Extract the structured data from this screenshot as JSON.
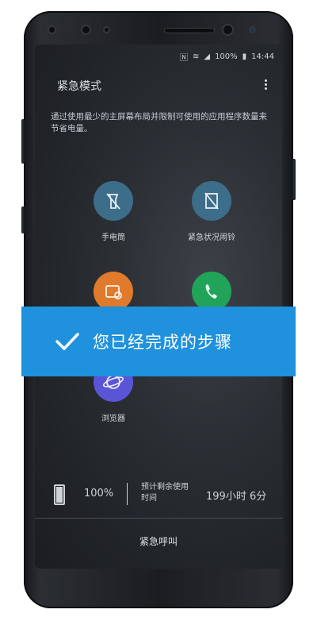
{
  "status_bar": {
    "battery": "100%",
    "time": "14:44"
  },
  "header": {
    "title": "紧急模式"
  },
  "description": "通过使用最少的主屏幕布局并限制可使用的应用程序数量来节省电量。",
  "apps": [
    {
      "label": "手电筒",
      "icon": "flashlight-off-icon",
      "color": "#3c6e8a"
    },
    {
      "label": "紧急状况闹铃",
      "icon": "alarm-bell-off-icon",
      "color": "#3c6e8a"
    },
    {
      "label": "",
      "icon": "share-location-icon",
      "color": "#e07a2c"
    },
    {
      "label": "",
      "icon": "phone-icon",
      "color": "#22a35a"
    },
    {
      "label": "浏览器",
      "icon": "browser-icon",
      "color": "#5a55d6"
    }
  ],
  "banner": {
    "text": "您已经完成的步骤",
    "color": "#1f91dd"
  },
  "battery_info": {
    "percent": "100%",
    "estimate_label": "预计剩余使用时间",
    "estimate_value": "199小时 6分"
  },
  "footer": {
    "emergency_call": "紧急呼叫"
  }
}
